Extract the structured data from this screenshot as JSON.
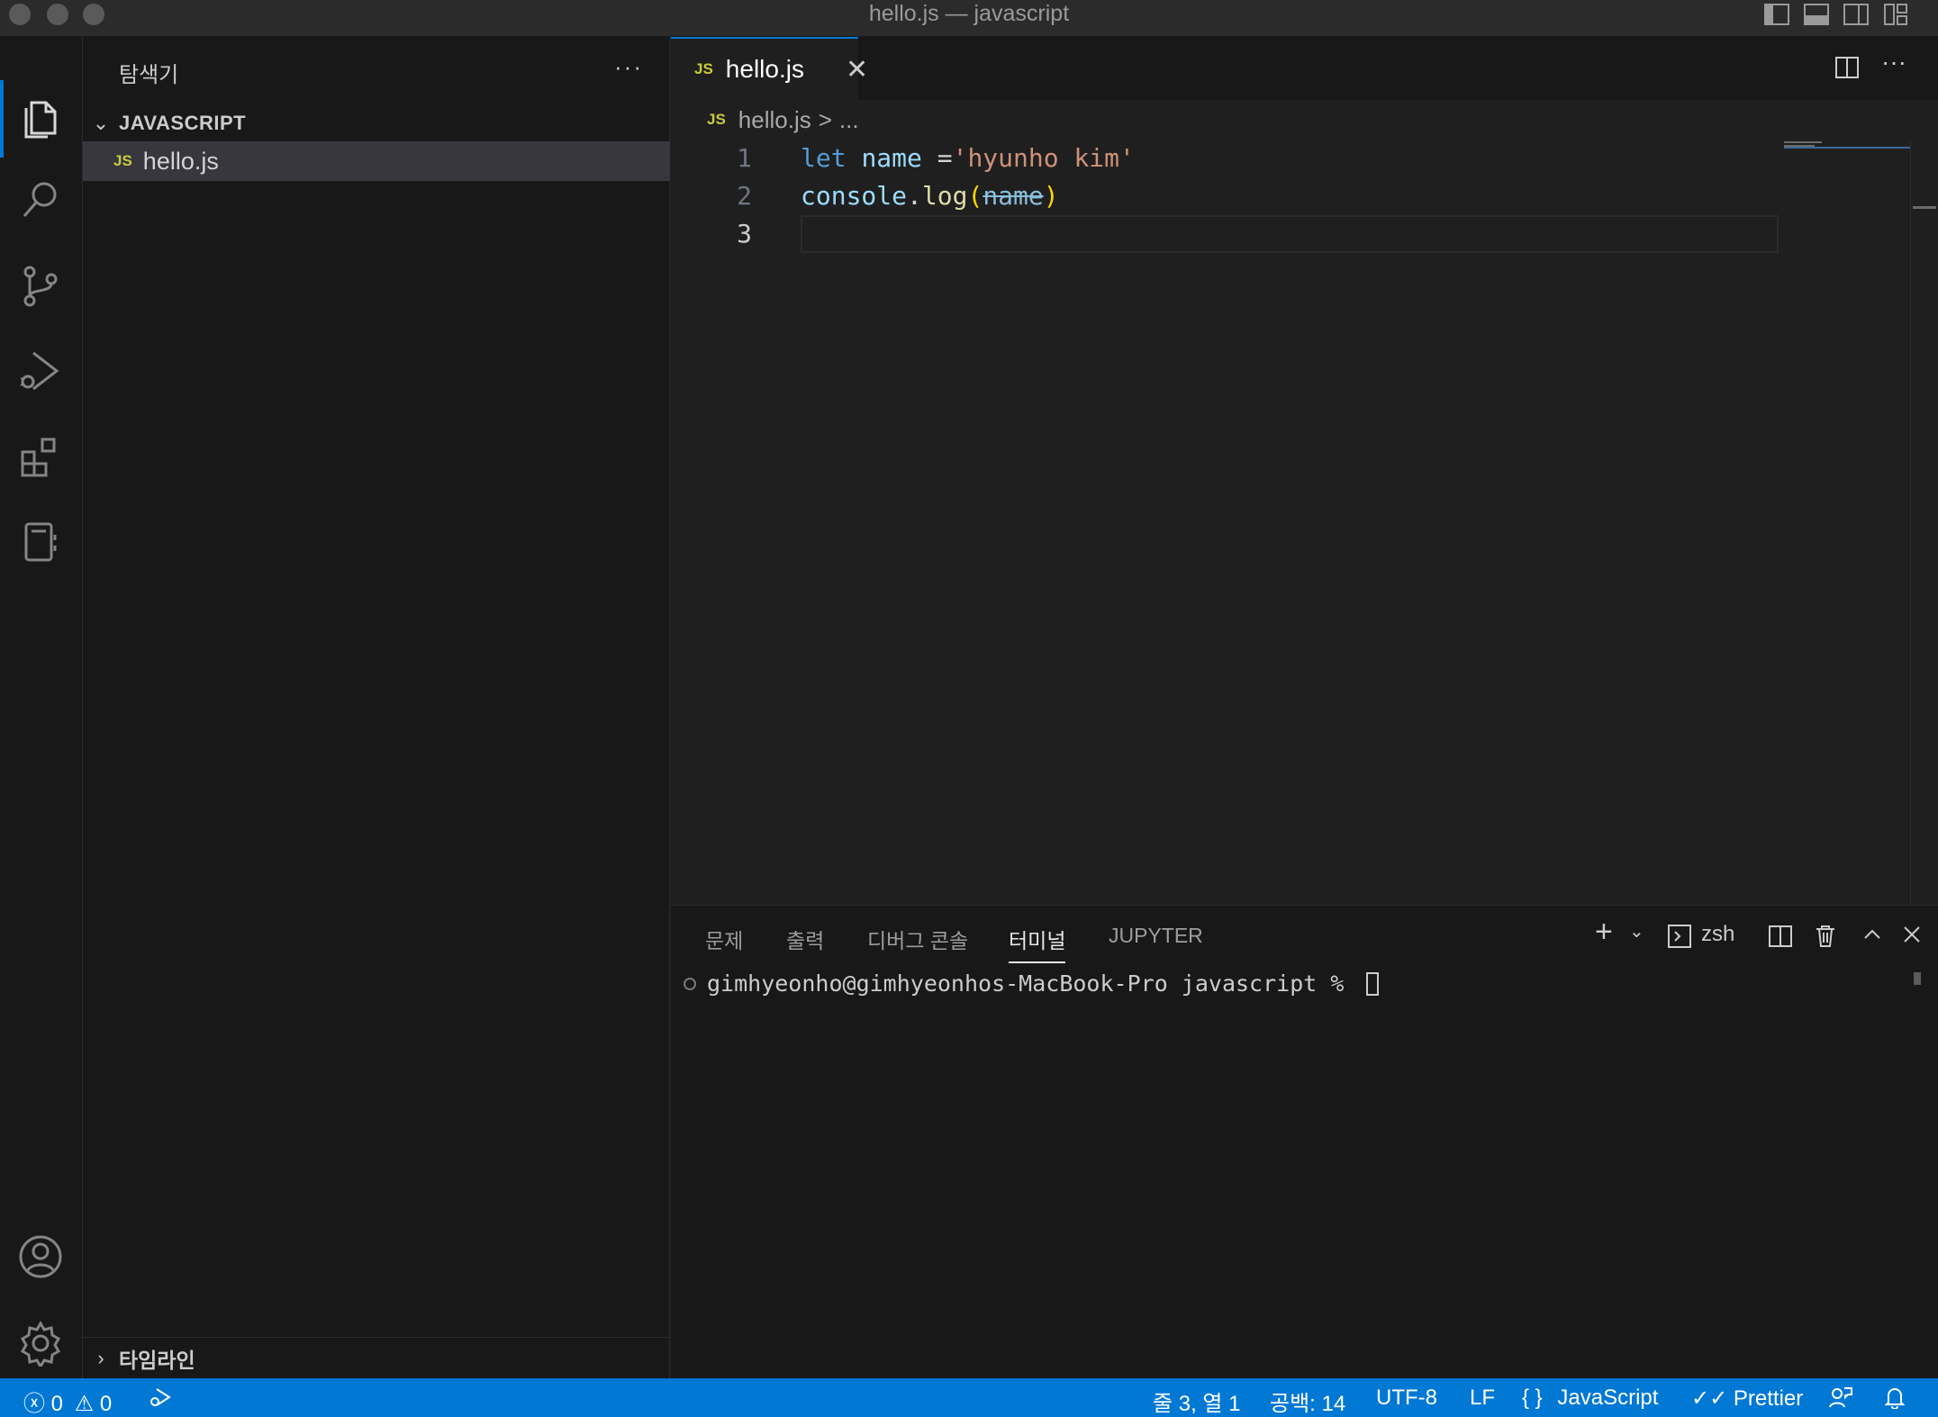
{
  "window": {
    "title": "hello.js — javascript"
  },
  "activity_bar": {
    "items": [
      "explorer",
      "search",
      "source-control",
      "run-and-debug",
      "extensions",
      "notebook"
    ],
    "bottom": [
      "accounts",
      "manage"
    ]
  },
  "sidebar": {
    "title": "탐색기",
    "more": "···",
    "folder": "JAVASCRIPT",
    "files": [
      {
        "badge": "JS",
        "name": "hello.js"
      }
    ],
    "timeline": "타임라인"
  },
  "editor": {
    "tab": {
      "badge": "JS",
      "name": "hello.js",
      "close": "✕"
    },
    "breadcrumb": {
      "badge": "JS",
      "file": "hello.js",
      "sep": ">",
      "rest": "..."
    },
    "lines": [
      {
        "num": "1",
        "tokens": [
          {
            "t": "let",
            "c": "kw"
          },
          {
            "t": " ",
            "c": "op"
          },
          {
            "t": "name",
            "c": "var"
          },
          {
            "t": " =",
            "c": "op"
          },
          {
            "t": "'hyunho kim'",
            "c": "str"
          }
        ]
      },
      {
        "num": "2",
        "tokens": [
          {
            "t": "console",
            "c": "var"
          },
          {
            "t": ".",
            "c": "op"
          },
          {
            "t": "log",
            "c": "fn"
          },
          {
            "t": "(",
            "c": "br"
          },
          {
            "t": "name",
            "c": "strike"
          },
          {
            "t": ")",
            "c": "br"
          }
        ]
      },
      {
        "num": "3",
        "tokens": []
      }
    ]
  },
  "panel": {
    "tabs": [
      "문제",
      "출력",
      "디버그 콘솔",
      "터미널",
      "JUPYTER"
    ],
    "active_tab": "터미널",
    "shell": "zsh",
    "prompt": "gimhyeonho@gimhyeonhos-MacBook-Pro javascript % "
  },
  "status": {
    "errors": "0",
    "warnings": "0",
    "position": "줄 3, 열 1",
    "spaces": "공백: 14",
    "encoding": "UTF-8",
    "eol": "LF",
    "language": "JavaScript",
    "formatter": "Prettier",
    "colors": {
      "bar": "#0078d4"
    }
  }
}
